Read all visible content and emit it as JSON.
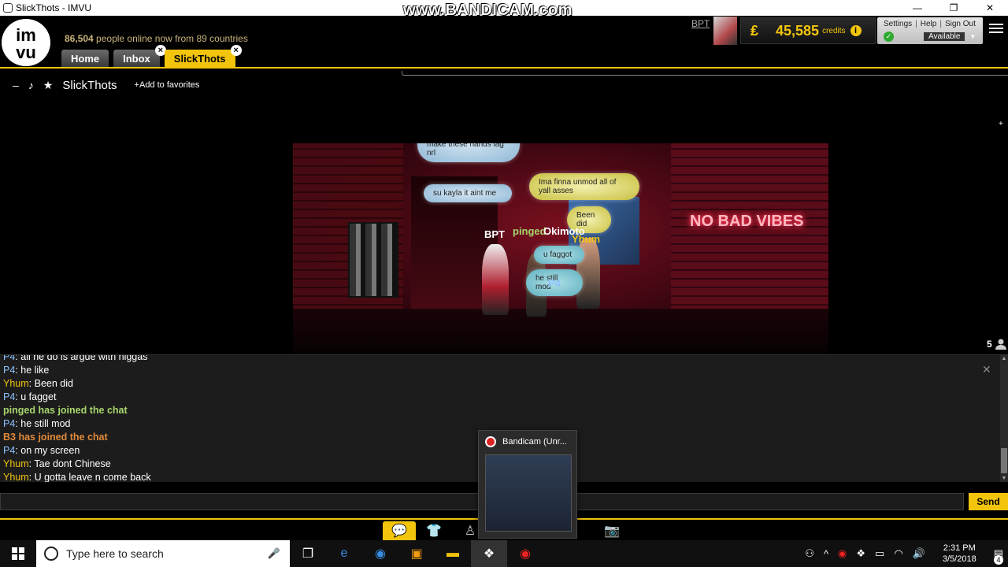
{
  "window": {
    "title": "SlickThots - IMVU"
  },
  "watermark": "www.BANDICAM.com",
  "header": {
    "online_count": "86,504",
    "online_text": "people online now from 89 countries",
    "user": "BPT",
    "credits_symbol": "₤",
    "credits_amount": "45,585",
    "credits_label": "credits",
    "links": [
      "Settings",
      "Help",
      "Sign Out"
    ],
    "status": "Available",
    "tabs": [
      {
        "label": "Home"
      },
      {
        "label": "Inbox"
      },
      {
        "label": "SlickThots"
      }
    ]
  },
  "roombar": {
    "minimize": "–",
    "music": "♪",
    "star": "★",
    "title": "SlickThots",
    "add_favorites": "Add to favorites",
    "add_prefix": "+"
  },
  "scene": {
    "neon_sign": "NO BAD VIBES",
    "bubbles": [
      "nigga u can make me lag on vu but cant make these hands lag nrl",
      "su kayla it aint me",
      "Ima finna unmod all of yall asses",
      "Been did",
      "u faggot",
      "he still mod"
    ],
    "names": [
      "BPT",
      "pinged",
      "Okimoto",
      "Yhum",
      "P4"
    ]
  },
  "occupants": "5",
  "chat": {
    "lines": [
      {
        "who": "P4",
        "text": "all he do is argue with niggas"
      },
      {
        "who": "P4",
        "text": "he like"
      },
      {
        "who": "Yhum",
        "text": "Been did"
      },
      {
        "who": "P4",
        "text": "u fagget"
      },
      {
        "system": "pinged has joined the chat"
      },
      {
        "who": "P4",
        "text": "he still mod"
      },
      {
        "system": "B3 has joined the chat"
      },
      {
        "who": "P4",
        "text": "on my screen"
      },
      {
        "who": "Yhum",
        "text": "Tae dont Chinese"
      },
      {
        "who": "Yhum",
        "text": "U gotta leave n come back"
      }
    ],
    "input_value": "",
    "send_label": "Send"
  },
  "bandicam_popup": {
    "title": "Bandicam (Unr..."
  },
  "taskbar": {
    "search_placeholder": "Type here to search",
    "time": "2:31 PM",
    "date": "3/5/2018",
    "notifications": "4"
  }
}
